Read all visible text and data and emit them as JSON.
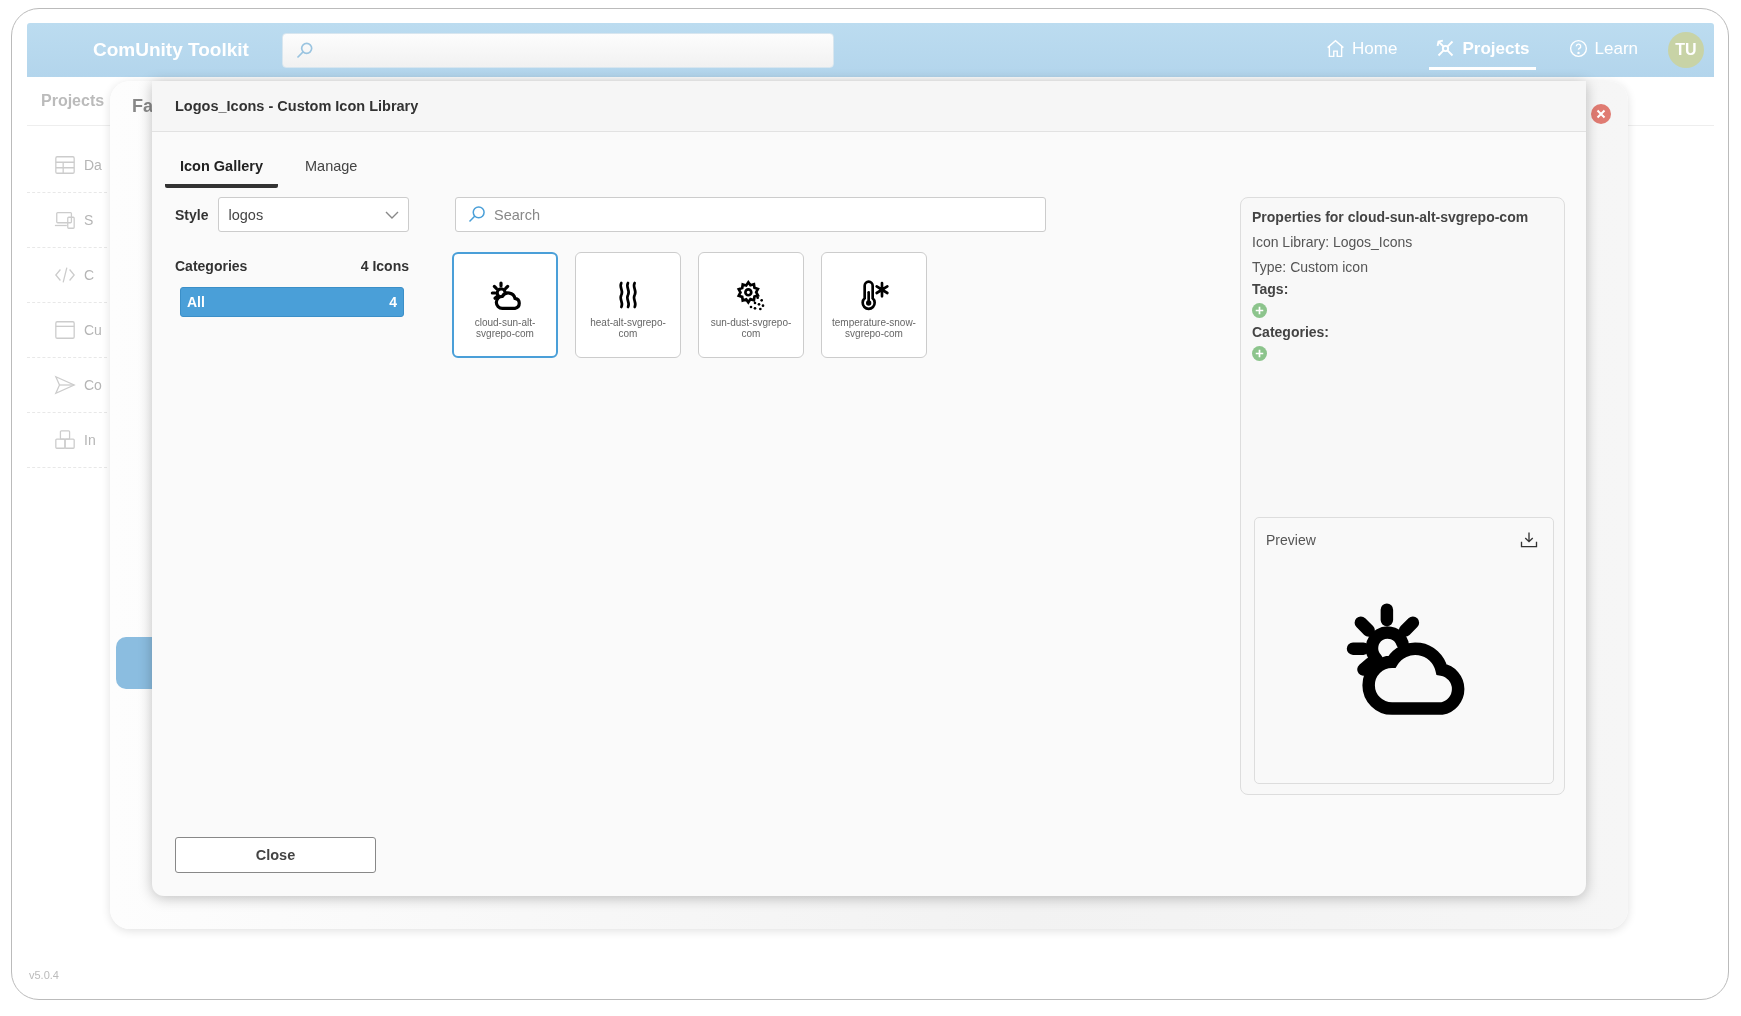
{
  "app": {
    "title": "ComUnity Toolkit",
    "version": "v5.0.4"
  },
  "nav": [
    {
      "label": "Home",
      "selected": false
    },
    {
      "label": "Projects",
      "selected": true
    },
    {
      "label": "Learn",
      "selected": false
    }
  ],
  "avatar": "TU",
  "background": {
    "breadcrumb": "Projects",
    "sidebar": [
      {
        "label": "Da"
      },
      {
        "label": "S"
      },
      {
        "label": "C"
      },
      {
        "label": "Cu"
      },
      {
        "label": "Co"
      },
      {
        "label": "In"
      }
    ],
    "dialog_title": "Fa"
  },
  "modal": {
    "title": "Logos_Icons - Custom Icon Library",
    "tabs": [
      {
        "label": "Icon Gallery",
        "selected": true
      },
      {
        "label": "Manage",
        "selected": false
      }
    ],
    "style": {
      "label": "Style",
      "value": "logos"
    },
    "categories": {
      "heading": "Categories",
      "count": "4 Icons",
      "items": [
        {
          "label": "All",
          "count": "4",
          "selected": true
        }
      ]
    },
    "search": {
      "placeholder": "Search"
    },
    "icons": [
      {
        "name": "cloud-sun-alt-svgrepo-com",
        "selected": true
      },
      {
        "name": "heat-alt-svgrepo-com",
        "selected": false
      },
      {
        "name": "sun-dust-svgrepo-com",
        "selected": false
      },
      {
        "name": "temperature-snow-svgrepo-com",
        "selected": false
      }
    ],
    "properties": {
      "title": "Properties for cloud-sun-alt-svgrepo-com",
      "library": "Icon Library: Logos_Icons",
      "type": "Type: Custom icon",
      "tags_label": "Tags:",
      "categories_label": "Categories:",
      "preview_label": "Preview"
    },
    "close_button": "Close"
  }
}
